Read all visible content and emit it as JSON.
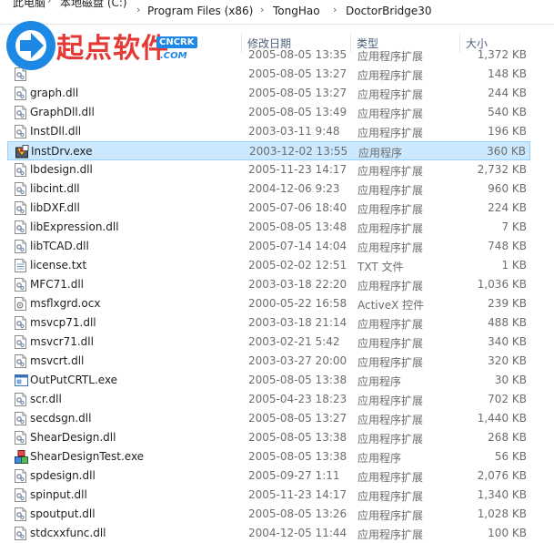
{
  "breadcrumb": [
    "此电脑",
    "本地磁盘 (C:)",
    "Program Files (x86)",
    "TongHao",
    "DoctorBridge30"
  ],
  "logo": {
    "text": "起点软件",
    "badge": "CNCRK",
    "sub": ".COM"
  },
  "columns": {
    "date": "修改日期",
    "type": "类型",
    "size": "大小"
  },
  "files": [
    {
      "name": "",
      "date": "2005-08-05 13:35",
      "type": "应用程序扩展",
      "size": "1,372 KB",
      "icon": "dll-icon"
    },
    {
      "name": "",
      "date": "2005-08-05 13:27",
      "type": "应用程序扩展",
      "size": "148 KB",
      "icon": "dll-icon"
    },
    {
      "name": "graph.dll",
      "date": "2005-08-05 13:27",
      "type": "应用程序扩展",
      "size": "244 KB",
      "icon": "dll-icon"
    },
    {
      "name": "GraphDll.dll",
      "date": "2005-08-05 13:49",
      "type": "应用程序扩展",
      "size": "540 KB",
      "icon": "dll-icon"
    },
    {
      "name": "InstDll.dll",
      "date": "2003-03-11 9:48",
      "type": "应用程序扩展",
      "size": "196 KB",
      "icon": "dll-icon"
    },
    {
      "name": "InstDrv.exe",
      "date": "2003-12-02 13:55",
      "type": "应用程序",
      "size": "360 KB",
      "icon": "installer-icon",
      "selected": true
    },
    {
      "name": "lbdesign.dll",
      "date": "2005-11-23 14:17",
      "type": "应用程序扩展",
      "size": "2,732 KB",
      "icon": "dll-icon"
    },
    {
      "name": "libcint.dll",
      "date": "2004-12-06 9:23",
      "type": "应用程序扩展",
      "size": "960 KB",
      "icon": "dll-icon"
    },
    {
      "name": "libDXF.dll",
      "date": "2005-07-06 18:40",
      "type": "应用程序扩展",
      "size": "224 KB",
      "icon": "dll-icon"
    },
    {
      "name": "libExpression.dll",
      "date": "2005-08-05 13:48",
      "type": "应用程序扩展",
      "size": "7 KB",
      "icon": "dll-icon"
    },
    {
      "name": "libTCAD.dll",
      "date": "2005-07-14 14:04",
      "type": "应用程序扩展",
      "size": "748 KB",
      "icon": "dll-icon"
    },
    {
      "name": "license.txt",
      "date": "2005-02-02 12:51",
      "type": "TXT 文件",
      "size": "1 KB",
      "icon": "text-file-icon"
    },
    {
      "name": "MFC71.dll",
      "date": "2003-03-18 22:20",
      "type": "应用程序扩展",
      "size": "1,036 KB",
      "icon": "dll-icon"
    },
    {
      "name": "msflxgrd.ocx",
      "date": "2000-05-22 16:58",
      "type": "ActiveX 控件",
      "size": "239 KB",
      "icon": "ocx-icon"
    },
    {
      "name": "msvcp71.dll",
      "date": "2003-03-18 21:14",
      "type": "应用程序扩展",
      "size": "488 KB",
      "icon": "dll-icon"
    },
    {
      "name": "msvcr71.dll",
      "date": "2003-02-21 5:42",
      "type": "应用程序扩展",
      "size": "340 KB",
      "icon": "dll-icon"
    },
    {
      "name": "msvcrt.dll",
      "date": "2003-03-27 20:00",
      "type": "应用程序扩展",
      "size": "320 KB",
      "icon": "dll-icon"
    },
    {
      "name": "OutPutCRTL.exe",
      "date": "2005-08-05 13:38",
      "type": "应用程序",
      "size": "30 KB",
      "icon": "app-window-icon"
    },
    {
      "name": "scr.dll",
      "date": "2005-04-23 18:23",
      "type": "应用程序扩展",
      "size": "702 KB",
      "icon": "dll-icon"
    },
    {
      "name": "secdsgn.dll",
      "date": "2005-08-05 13:27",
      "type": "应用程序扩展",
      "size": "1,440 KB",
      "icon": "dll-icon"
    },
    {
      "name": "ShearDesign.dll",
      "date": "2005-08-05 13:38",
      "type": "应用程序扩展",
      "size": "268 KB",
      "icon": "dll-icon"
    },
    {
      "name": "ShearDesignTest.exe",
      "date": "2005-08-05 13:38",
      "type": "应用程序",
      "size": "56 KB",
      "icon": "app-blocks-icon"
    },
    {
      "name": "spdesign.dll",
      "date": "2005-09-27 1:11",
      "type": "应用程序扩展",
      "size": "2,076 KB",
      "icon": "dll-icon"
    },
    {
      "name": "spinput.dll",
      "date": "2005-11-23 14:17",
      "type": "应用程序扩展",
      "size": "1,340 KB",
      "icon": "dll-icon"
    },
    {
      "name": "spoutput.dll",
      "date": "2005-08-05 13:26",
      "type": "应用程序扩展",
      "size": "1,028 KB",
      "icon": "dll-icon"
    },
    {
      "name": "stdcxxfunc.dll",
      "date": "2004-12-05 11:44",
      "type": "应用程序扩展",
      "size": "100 KB",
      "icon": "dll-icon"
    }
  ]
}
